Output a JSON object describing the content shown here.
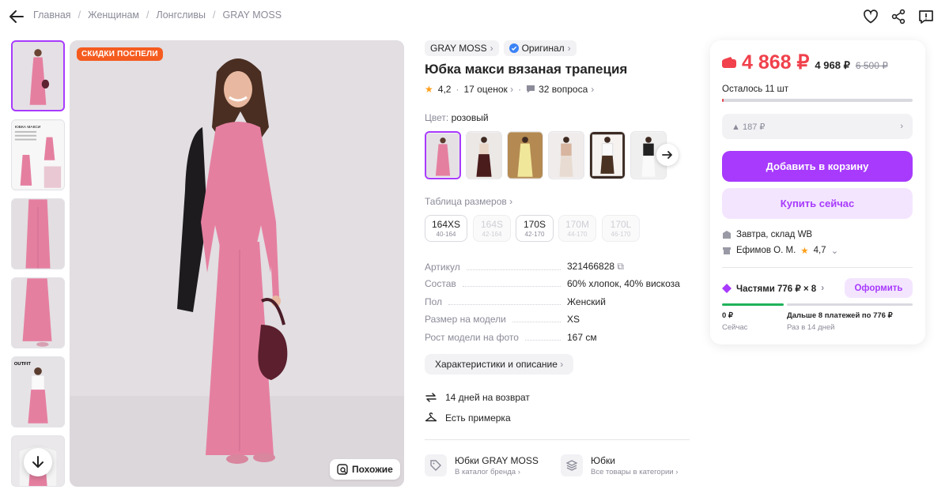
{
  "breadcrumb": [
    "Главная",
    "Женщинам",
    "Лонгсливы",
    "GRAY MOSS"
  ],
  "gallery": {
    "badge": "СКИДКИ ПОСПЕЛИ",
    "similar_label": "Похожие",
    "thumb_text": "ЮБКА МАКСИ",
    "outfit_label": "OUTFIT"
  },
  "product": {
    "brand": "GRAY MOSS",
    "original": "Оригинал",
    "title": "Юбка макси вязаная трапеция",
    "rating": "4,2",
    "reviews": "17 оценок",
    "questions": "32 вопроса",
    "color_label": "Цвет:",
    "color_value": "розовый",
    "size_table": "Таблица размеров",
    "sizes": [
      {
        "label": "164XS",
        "sub": "40-164",
        "available": true
      },
      {
        "label": "164S",
        "sub": "42-164",
        "available": false
      },
      {
        "label": "170S",
        "sub": "42-170",
        "available": true
      },
      {
        "label": "170M",
        "sub": "44-170",
        "available": false
      },
      {
        "label": "170L",
        "sub": "46-170",
        "available": false
      }
    ],
    "specs": [
      {
        "key": "Артикул",
        "value": "321466828"
      },
      {
        "key": "Состав",
        "value": "60% хлопок, 40% вискоза"
      },
      {
        "key": "Пол",
        "value": "Женский"
      },
      {
        "key": "Размер на модели",
        "value": "XS"
      },
      {
        "key": "Рост модели на фото",
        "value": "167 см"
      }
    ],
    "details_button": "Характеристики и описание",
    "return_text": "14 дней на возврат",
    "fitting_text": "Есть примерка",
    "brand_link": {
      "title": "Юбки GRAY MOSS",
      "sub": "В каталог бренда"
    },
    "category_link": {
      "title": "Юбки",
      "sub": "Все товары в категории"
    }
  },
  "buy": {
    "price": "4 868 ₽",
    "price_mid": "4 968 ₽",
    "price_old": "6 500 ₽",
    "stock_text": "Осталось 11 шт",
    "stock_fraction": 0.01,
    "alt_price": "187 ₽",
    "cart_button": "Добавить в корзину",
    "buy_now_button": "Купить сейчас",
    "delivery": "Завтра, склад WB",
    "seller": "Ефимов О. М.",
    "seller_rating": "4,7",
    "installments": "Частями 776 ₽ × 8",
    "installments_button": "Оформить",
    "now_amount": "0 ₽",
    "now_label": "Сейчас",
    "next_amount": "Дальше 8 платежей по 776 ₽",
    "next_label": "Раз в 14 дней"
  },
  "colors": {
    "accent": "#a73afd",
    "price": "#f0414c",
    "promo": "#f55b1f",
    "skirt": "#e57fa0"
  }
}
